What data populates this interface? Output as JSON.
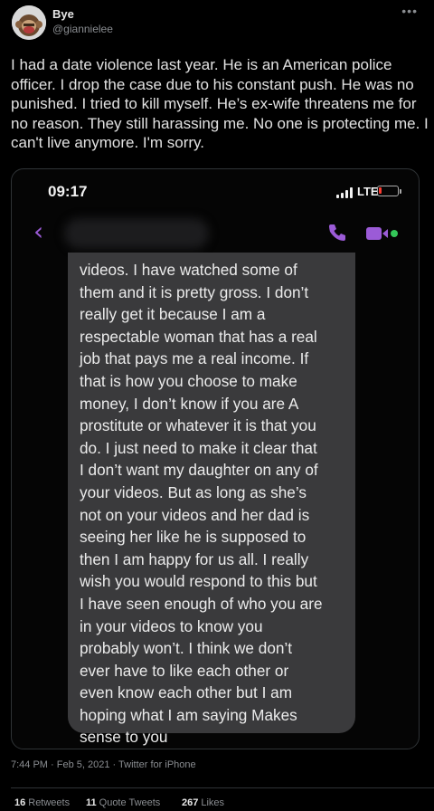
{
  "user": {
    "name": "Bye",
    "handle": "@giannielee",
    "avatar_icon": "monkey-emoji-icon"
  },
  "tweet": {
    "text": "I had a date violence last year. He is an American police officer. I drop the case due to his constant push. He was no punished. I tried to kill myself. He’s ex-wife threatens me for no reason. They still harassing me. No one is protecting me. I can't live anymore. I'm sorry."
  },
  "screenshot": {
    "time": "09:17",
    "network": "LTE",
    "battery_level": 0.15,
    "accent_color": "#9b5bd7",
    "message": "videos. I have watched some of\nthem and it is pretty gross. I don’t\nreally get it because I am a\nrespectable woman that has a real\njob that pays me a real income. If\nthat is how you choose to make\nmoney, I don’t know if you are A\nprostitute or whatever it is that you\ndo. I just need to make it clear that\nI don’t want my daughter on any of\nyour videos. But as long as she’s\nnot on your videos and her dad is\nseeing her like he is supposed to\nthen I am happy for us all. I really\nwish you would respond to this but\nI have seen enough of who you are\nin your videos to know you\nprobably won’t. I think we don’t\never have to like each other or\neven know each other but I am\nhoping what I am saying Makes\nsense to you"
  },
  "meta": {
    "timestamp": "7:44 PM · Feb 5, 2021 · ",
    "source": "Twitter for iPhone"
  },
  "stats": {
    "retweets_count": "16",
    "retweets_label": "Retweets",
    "quotes_count": "11",
    "quotes_label": "Quote Tweets",
    "likes_count": "267",
    "likes_label": "Likes"
  }
}
